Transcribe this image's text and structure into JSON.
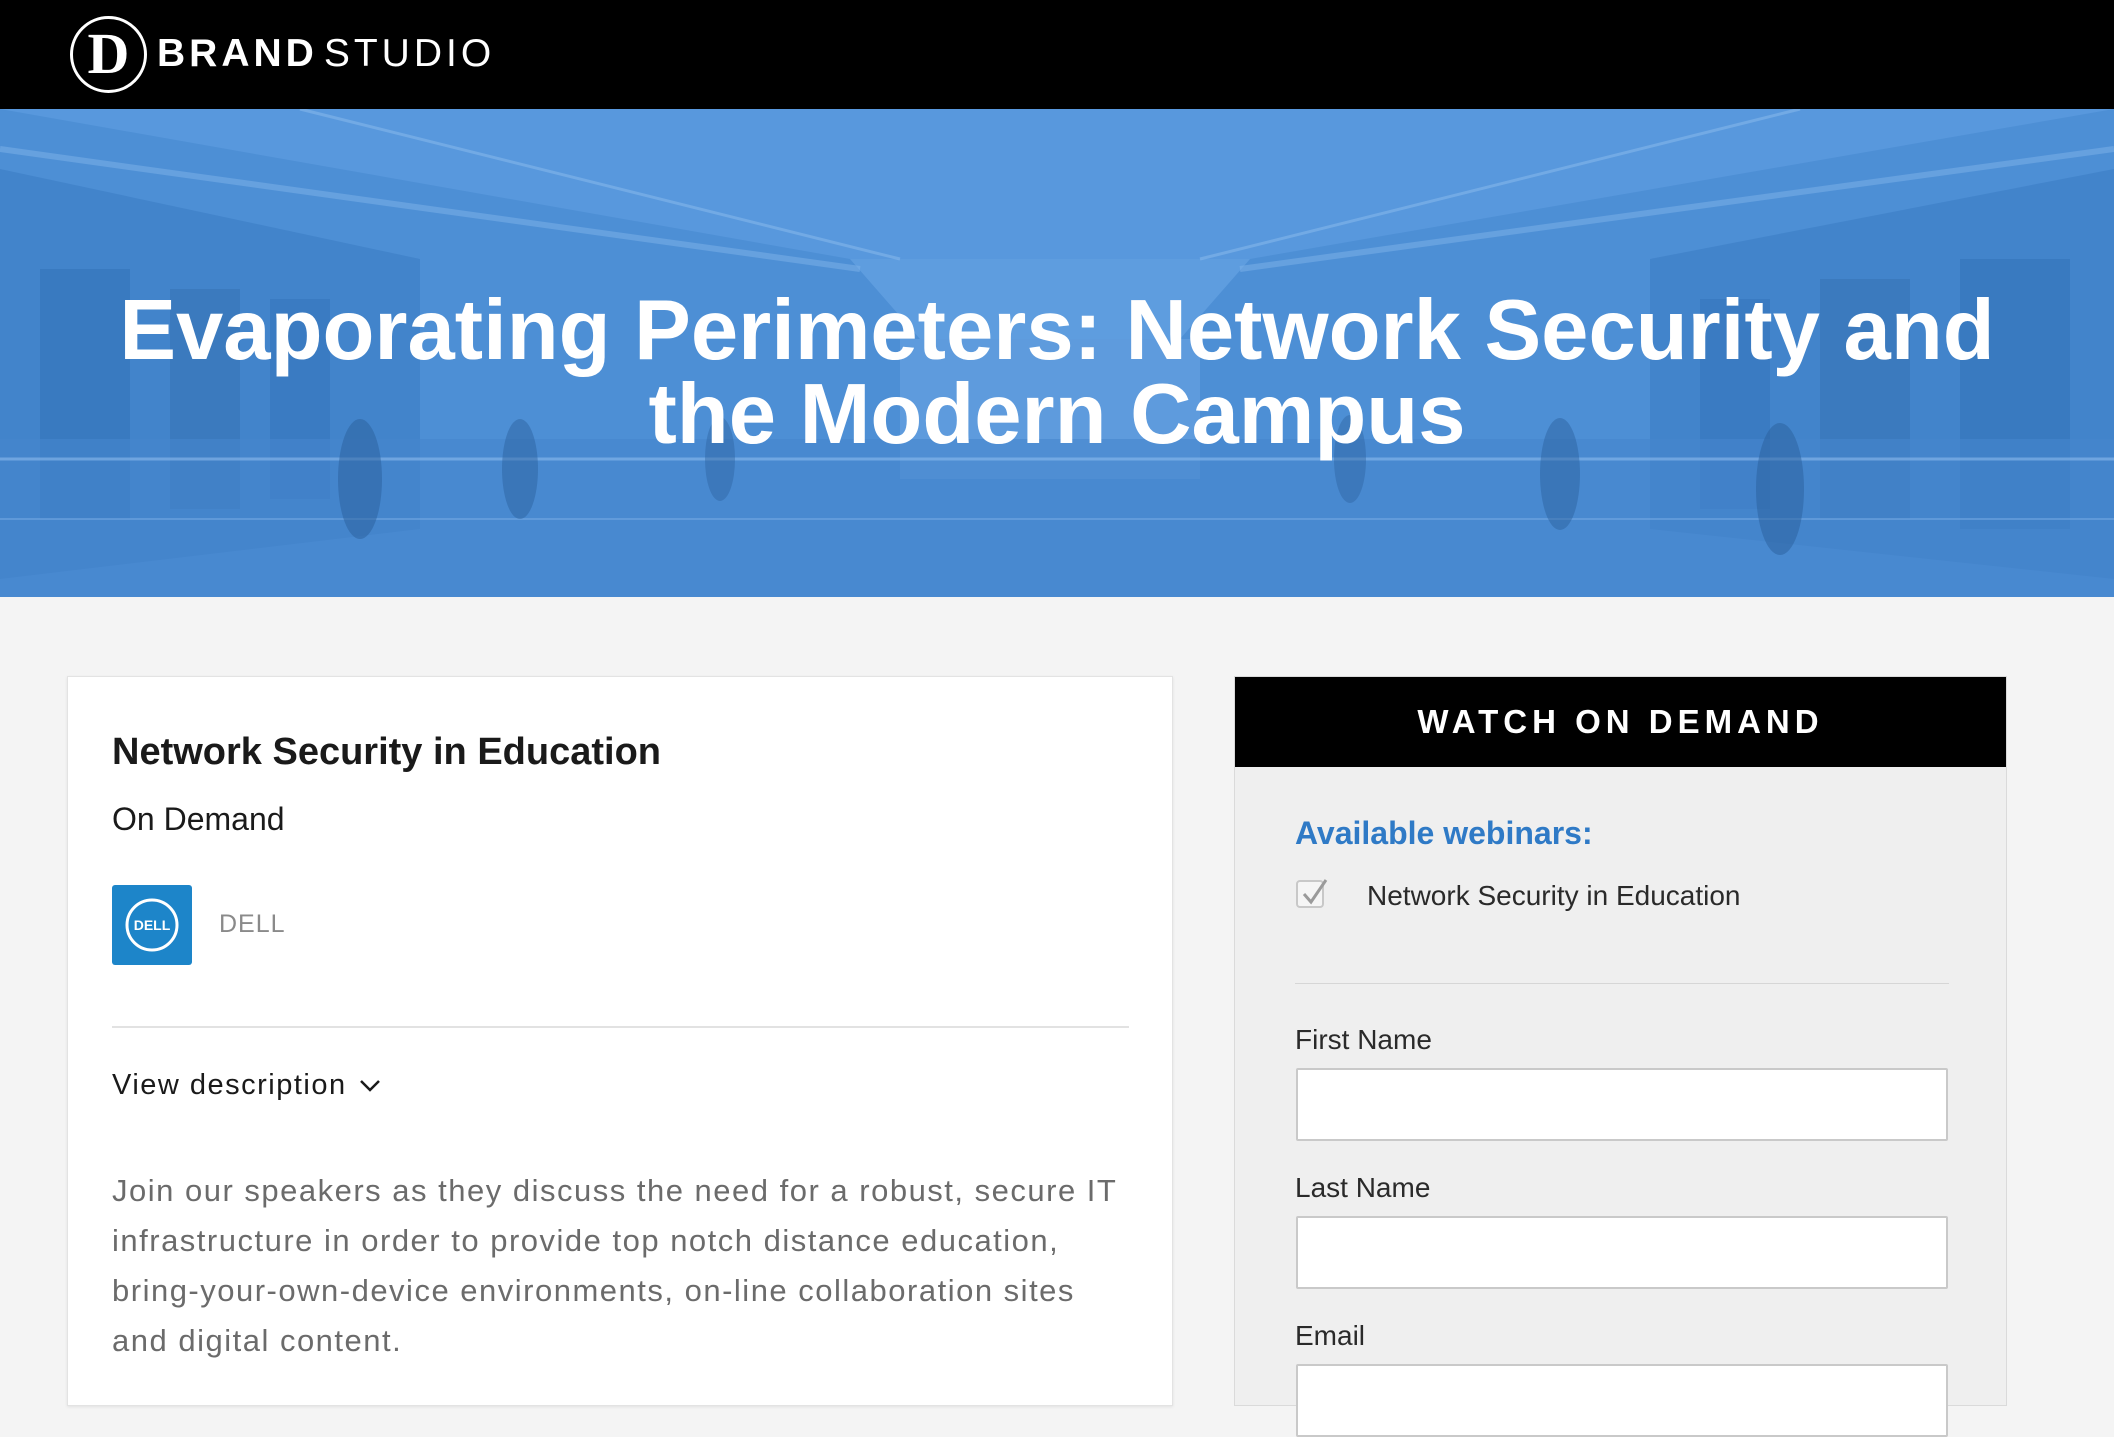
{
  "header": {
    "logo_letter": "D",
    "logo_brand": "BRAND",
    "logo_studio": "STUDIO"
  },
  "hero": {
    "title_line1": "Evaporating Perimeters: Network Security and",
    "title_line2": "the Modern Campus",
    "overlay_color": "#4a8fd6"
  },
  "event": {
    "title": "Network Security in Education",
    "status": "On Demand",
    "sponsor_logo_text": "DELL",
    "sponsor_name": "DELL",
    "view_description_label": "View description",
    "description": "Join our speakers as they discuss the need for a robust, secure IT infrastructure in order to provide top notch distance education, bring-your-own-device environments, on-line collaboration sites and digital content."
  },
  "form": {
    "header": "WATCH ON DEMAND",
    "available_label": "Available webinars:",
    "webinars": [
      {
        "label": "Network Security in Education",
        "checked": true
      }
    ],
    "fields": [
      {
        "label": "First Name",
        "value": ""
      },
      {
        "label": "Last Name",
        "value": ""
      },
      {
        "label": "Email",
        "value": ""
      }
    ]
  },
  "colors": {
    "accent_blue": "#2f7ac6",
    "dell_blue": "#1d85c9",
    "header_black": "#000000"
  }
}
